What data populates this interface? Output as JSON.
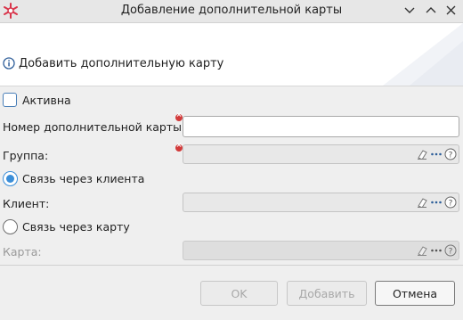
{
  "window": {
    "title": "Добавление дополнительной карты",
    "icon": "snowflake-app-icon",
    "controls": [
      "minimize-chevron-down-icon",
      "maximize-chevron-up-icon",
      "close-icon"
    ]
  },
  "header": {
    "icon": "info-icon",
    "text": "Добавить дополнительную карту"
  },
  "form": {
    "active_label": "Активна",
    "active_checked": false,
    "card_number_label": "Номер дополнительной карты:",
    "card_number_value": "",
    "group_label": "Группа:",
    "link_client_label": "Связь через клиента",
    "link_client_selected": true,
    "client_label": "Клиент:",
    "link_card_label": "Связь через карту",
    "link_card_selected": false,
    "card_label": "Карта:"
  },
  "buttons": {
    "ok": "OK",
    "add": "Добавить",
    "cancel": "Отмена"
  },
  "colors": {
    "accent": "#3b8ed8",
    "required": "#d23a3a",
    "app_icon": "#d9344a"
  }
}
